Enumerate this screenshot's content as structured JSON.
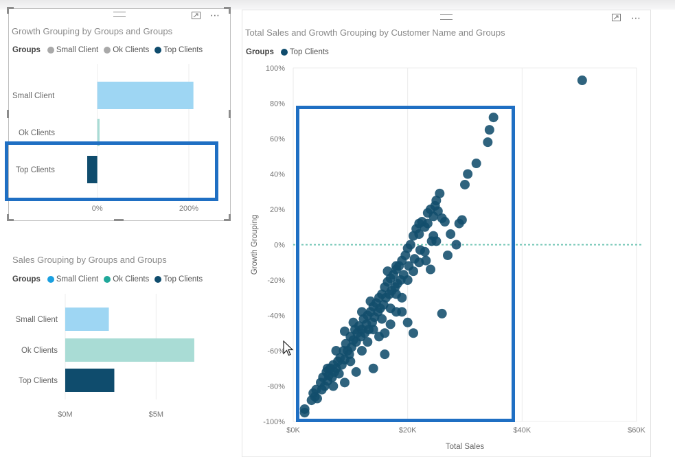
{
  "colors": {
    "small": "#9ed6f3",
    "ok": "#a9dcd5",
    "top": "#0f4c6d",
    "legend_small_v1": "#a9a9a9",
    "legend_ok_v1": "#a9a9a9",
    "legend_small_v2": "#1aa0e0",
    "legend_ok_v2": "#20a89a",
    "dot": "#124d6c",
    "zero_line": "#6ec4b3",
    "highlight": "#1f6fc3"
  },
  "icons": {
    "drag": "drag-handle-icon",
    "focus": "focus-mode-icon",
    "more": "more-options-icon",
    "cursor": "mouse-cursor-icon"
  },
  "visual1": {
    "title": "Growth Grouping by Groups and Groups",
    "legend_title": "Groups",
    "legend": [
      "Small Client",
      "Ok Clients",
      "Top Clients"
    ],
    "more": "⋯"
  },
  "visual2": {
    "title": "Sales Grouping by Groups and Groups",
    "legend_title": "Groups",
    "legend": [
      "Small Client",
      "Ok Clients",
      "Top Clients"
    ]
  },
  "visual3": {
    "title": "Total Sales and Growth Grouping by Customer Name and Groups",
    "legend_title": "Groups",
    "legend": [
      "Top Clients"
    ],
    "more": "⋯"
  },
  "chart_data": [
    {
      "type": "bar",
      "orientation": "horizontal",
      "title": "Growth Grouping by Groups and Groups",
      "categories": [
        "Small Client",
        "Ok Clients",
        "Top Clients"
      ],
      "values": [
        2.1,
        0.05,
        -0.22
      ],
      "xticks": [
        "0%",
        "200%"
      ],
      "xtick_values": [
        0,
        2
      ],
      "xlim": [
        -0.25,
        2.75
      ],
      "legend_position": "top-left"
    },
    {
      "type": "bar",
      "orientation": "horizontal",
      "title": "Sales Grouping by Groups and Groups",
      "categories": [
        "Small Client",
        "Ok Clients",
        "Top Clients"
      ],
      "values": [
        2.4,
        7.1,
        2.7
      ],
      "xticks": [
        "$0M",
        "$5M"
      ],
      "xtick_values": [
        0,
        5
      ],
      "xlim": [
        0,
        8.5
      ],
      "legend_position": "top-left"
    },
    {
      "type": "scatter",
      "title": "Total Sales and Growth Grouping by Customer Name and Groups",
      "xlabel": "Total Sales",
      "ylabel": "Growth Grouping",
      "xlim": [
        0,
        60000
      ],
      "ylim": [
        -1,
        1
      ],
      "xticks": [
        "$0K",
        "$20K",
        "$40K",
        "$60K"
      ],
      "xtick_values": [
        0,
        20000,
        40000,
        60000
      ],
      "yticks": [
        "100%",
        "80%",
        "60%",
        "40%",
        "20%",
        "0%",
        "-20%",
        "-40%",
        "-60%",
        "-80%",
        "-100%"
      ],
      "ytick_values": [
        1,
        0.8,
        0.6,
        0.4,
        0.2,
        0,
        -0.2,
        -0.4,
        -0.6,
        -0.8,
        -1
      ],
      "grid": true,
      "legend_position": "top-left",
      "series": [
        {
          "name": "Top Clients",
          "points": [
            [
              2000,
              -0.93
            ],
            [
              2000,
              -0.95
            ],
            [
              3200,
              -0.88
            ],
            [
              3500,
              -0.84
            ],
            [
              3800,
              -0.86
            ],
            [
              4000,
              -0.82
            ],
            [
              4200,
              -0.87
            ],
            [
              4800,
              -0.78
            ],
            [
              5000,
              -0.82
            ],
            [
              5200,
              -0.75
            ],
            [
              5500,
              -0.8
            ],
            [
              5800,
              -0.72
            ],
            [
              6000,
              -0.77
            ],
            [
              6200,
              -0.74
            ],
            [
              6500,
              -0.7
            ],
            [
              6800,
              -0.75
            ],
            [
              7000,
              -0.68
            ],
            [
              7200,
              -0.72
            ],
            [
              7500,
              -0.7
            ],
            [
              7800,
              -0.66
            ],
            [
              8000,
              -0.73
            ],
            [
              8200,
              -0.64
            ],
            [
              8500,
              -0.68
            ],
            [
              8800,
              -0.6
            ],
            [
              9000,
              -0.65
            ],
            [
              9200,
              -0.56
            ],
            [
              9500,
              -0.6
            ],
            [
              9800,
              -0.62
            ],
            [
              10000,
              -0.52
            ],
            [
              10200,
              -0.58
            ],
            [
              10500,
              -0.54
            ],
            [
              10800,
              -0.48
            ],
            [
              11000,
              -0.55
            ],
            [
              11200,
              -0.5
            ],
            [
              11500,
              -0.46
            ],
            [
              11800,
              -0.52
            ],
            [
              12000,
              -0.48
            ],
            [
              12300,
              -0.42
            ],
            [
              12500,
              -0.5
            ],
            [
              12800,
              -0.45
            ],
            [
              13000,
              -0.4
            ],
            [
              13200,
              -0.48
            ],
            [
              13500,
              -0.38
            ],
            [
              13800,
              -0.44
            ],
            [
              14000,
              -0.35
            ],
            [
              14200,
              -0.41
            ],
            [
              14500,
              -0.33
            ],
            [
              14800,
              -0.38
            ],
            [
              15000,
              -0.3
            ],
            [
              15200,
              -0.36
            ],
            [
              15500,
              -0.28
            ],
            [
              15800,
              -0.34
            ],
            [
              16000,
              -0.24
            ],
            [
              16200,
              -0.3
            ],
            [
              16500,
              -0.21
            ],
            [
              16800,
              -0.28
            ],
            [
              17000,
              -0.19
            ],
            [
              17200,
              -0.26
            ],
            [
              17500,
              -0.17
            ],
            [
              17800,
              -0.24
            ],
            [
              18000,
              -0.14
            ],
            [
              18200,
              -0.22
            ],
            [
              18500,
              -0.12
            ],
            [
              18800,
              -0.2
            ],
            [
              19000,
              -0.09
            ],
            [
              19300,
              -0.17
            ],
            [
              19600,
              -0.06
            ],
            [
              20000,
              -0.02
            ],
            [
              20200,
              -0.12
            ],
            [
              20500,
              0.0
            ],
            [
              21000,
              0.05
            ],
            [
              21200,
              -0.08
            ],
            [
              21500,
              0.09
            ],
            [
              22000,
              0.12
            ],
            [
              22200,
              -0.03
            ],
            [
              22500,
              0.13
            ],
            [
              23000,
              0.1
            ],
            [
              23200,
              -0.09
            ],
            [
              23500,
              0.18
            ],
            [
              24000,
              0.2
            ],
            [
              24200,
              0.02
            ],
            [
              24500,
              0.16
            ],
            [
              24800,
              0.22
            ],
            [
              25000,
              0.25
            ],
            [
              25300,
              0.19
            ],
            [
              25600,
              0.29
            ],
            [
              26000,
              0.15
            ],
            [
              26500,
              0.13
            ],
            [
              27500,
              0.06
            ],
            [
              28500,
              0.0
            ],
            [
              29000,
              0.12
            ],
            [
              29500,
              0.14
            ],
            [
              30000,
              0.34
            ],
            [
              30500,
              0.4
            ],
            [
              32000,
              0.46
            ],
            [
              34000,
              0.58
            ],
            [
              34300,
              0.65
            ],
            [
              35000,
              0.72
            ],
            [
              6000,
              -0.7
            ],
            [
              7500,
              -0.6
            ],
            [
              9000,
              -0.49
            ],
            [
              10500,
              -0.44
            ],
            [
              12000,
              -0.38
            ],
            [
              13000,
              -0.55
            ],
            [
              14000,
              -0.48
            ],
            [
              15000,
              -0.52
            ],
            [
              16000,
              -0.5
            ],
            [
              17000,
              -0.45
            ],
            [
              18000,
              -0.38
            ],
            [
              19000,
              -0.3
            ],
            [
              20000,
              -0.2
            ],
            [
              21000,
              -0.15
            ],
            [
              22000,
              -0.1
            ],
            [
              23000,
              -0.04
            ],
            [
              24000,
              -0.14
            ],
            [
              25000,
              0.02
            ],
            [
              26000,
              -0.39
            ],
            [
              27000,
              -0.06
            ],
            [
              20000,
              -0.44
            ],
            [
              21000,
              -0.5
            ],
            [
              16000,
              -0.62
            ],
            [
              14000,
              -0.7
            ],
            [
              11000,
              -0.72
            ],
            [
              9000,
              -0.78
            ],
            [
              7000,
              -0.8
            ],
            [
              12000,
              -0.6
            ],
            [
              10000,
              -0.66
            ],
            [
              17000,
              -0.36
            ],
            [
              18000,
              -0.28
            ],
            [
              19000,
              -0.38
            ],
            [
              15500,
              -0.42
            ],
            [
              13500,
              -0.32
            ],
            [
              16500,
              -0.15
            ],
            [
              18000,
              -0.12
            ],
            [
              22000,
              0.06
            ],
            [
              23500,
              0.12
            ],
            [
              24500,
              0.05
            ],
            [
              50500,
              0.93
            ]
          ]
        }
      ]
    }
  ]
}
